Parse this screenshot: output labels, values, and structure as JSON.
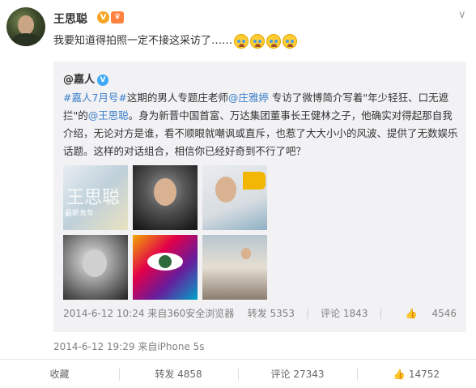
{
  "user": {
    "name": "王思聪"
  },
  "post": {
    "text": "我要知道得拍照一定不接这采访了……",
    "emoji_count": 4,
    "meta": "2014-6-12 19:29 来自iPhone 5s"
  },
  "repost": {
    "user": "@嘉人",
    "body_parts": [
      {
        "text": "#嘉人7月号#",
        "link": true
      },
      {
        "text": "这期的男人专题庄老师",
        "link": false
      },
      {
        "text": "@庄雅婷",
        "link": true
      },
      {
        "text": " 专访了微博简介写着\"年少轻狂、口无遮拦\"的",
        "link": false
      },
      {
        "text": "@王思聪",
        "link": true
      },
      {
        "text": "。身为新晋中国首富、万达集团董事长王健林之子，他确实对得起那自我介绍，无论对方是谁，看不顺眼就嘲讽或直斥，也惹了大大小小的风波、提供了无数娱乐话题。这样的对话组合，相信你已经好奇到不行了吧？",
        "link": false
      }
    ],
    "pic1_text": "王思聪",
    "pic1_sub": "最新青年",
    "meta": "2014-6-12 10:24 来自360安全浏览器",
    "forward": "转发 5353",
    "comment": "评论 1843",
    "like": "4546"
  },
  "actions": {
    "favorite": "收藏",
    "forward": "转发 4858",
    "comment": "评论 27343",
    "like": "14752"
  },
  "colors": {
    "link": "#3a7fc9",
    "repost_bg": "#f2f2f5",
    "meta_text": "#808080"
  }
}
